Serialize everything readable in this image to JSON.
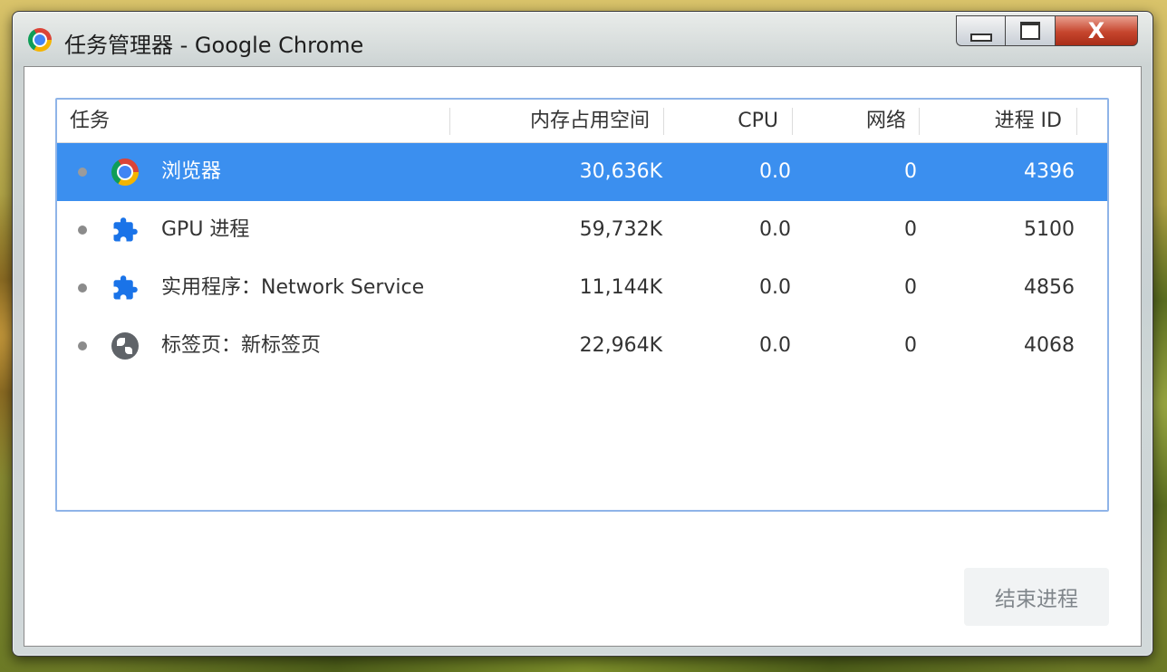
{
  "window": {
    "title": "任务管理器 - Google Chrome",
    "controls": {
      "minimize": "",
      "maximize": "",
      "close": "X"
    }
  },
  "table": {
    "columns": [
      "任务",
      "内存占用空间",
      "CPU",
      "网络",
      "进程 ID"
    ],
    "rows": [
      {
        "task": "浏览器",
        "icon": "chrome-icon",
        "memory": "30,636K",
        "cpu": "0.0",
        "network": "0",
        "pid": "4396",
        "selected": true
      },
      {
        "task": "GPU 进程",
        "icon": "puzzle-icon",
        "memory": "59,732K",
        "cpu": "0.0",
        "network": "0",
        "pid": "5100",
        "selected": false
      },
      {
        "task": "实用程序：Network Service",
        "icon": "puzzle-icon",
        "memory": "11,144K",
        "cpu": "0.0",
        "network": "0",
        "pid": "4856",
        "selected": false
      },
      {
        "task": "标签页：新标签页",
        "icon": "globe-icon",
        "memory": "22,964K",
        "cpu": "0.0",
        "network": "0",
        "pid": "4068",
        "selected": false
      }
    ]
  },
  "actions": {
    "end_process": "结束进程"
  },
  "colors": {
    "selection": "#3b8fef",
    "table_border": "#8fb4e8",
    "puzzle": "#1a73e8"
  }
}
